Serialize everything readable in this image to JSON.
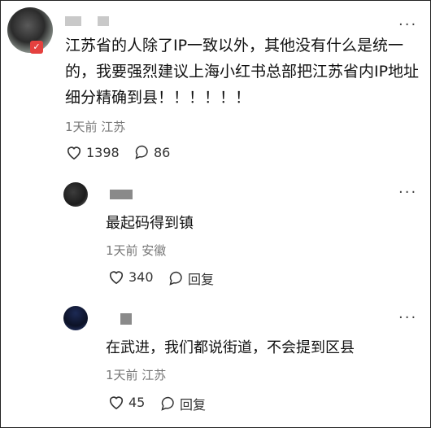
{
  "main_comment": {
    "text": "江苏省的人除了IP一致以外，其他没有什么是统一的，我要强烈建议上海小红书总部把江苏省内IP地址细分精确到县！！！！！！",
    "meta": "1天前 江苏",
    "likes": "1398",
    "replies": "86"
  },
  "reply_1": {
    "text": "最起码得到镇",
    "meta": "1天前 安徽",
    "likes": "340",
    "reply_label": "回复"
  },
  "reply_2": {
    "text": "在武进，我们都说街道，不会提到区县",
    "meta": "1天前 江苏",
    "likes": "45",
    "reply_label": "回复"
  },
  "more_glyph": "···"
}
